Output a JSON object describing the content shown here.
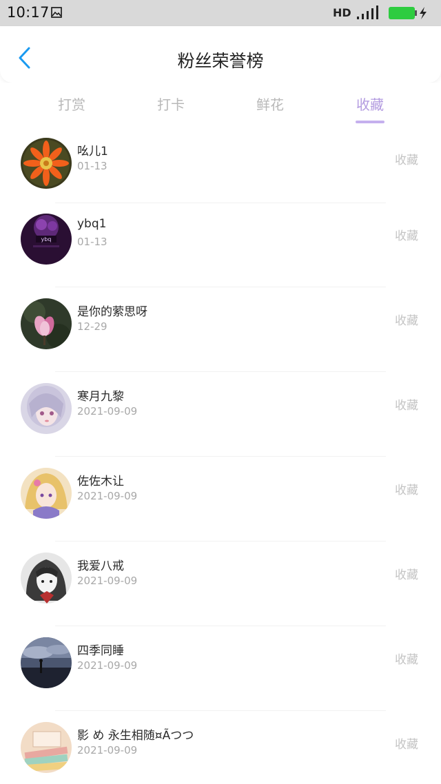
{
  "status_bar": {
    "time": "10:17",
    "network": "HD",
    "icons": [
      "gallery-icon",
      "signal-icon",
      "battery-icon"
    ],
    "battery_color": "#2ecc40"
  },
  "header": {
    "title": "粉丝荣誉榜",
    "back_icon": "chevron-left-icon",
    "accent": "#1a9af0"
  },
  "tabs": [
    {
      "label": "打赏",
      "active": false
    },
    {
      "label": "打卡",
      "active": false
    },
    {
      "label": "鲜花",
      "active": false
    },
    {
      "label": "收藏",
      "active": true
    }
  ],
  "active_tab_color": "#b39be0",
  "fans": [
    {
      "name": "吆儿1",
      "date": "01-13",
      "action": "收藏",
      "avatar": "orange-flower"
    },
    {
      "name": "ybq1",
      "date": "01-13",
      "action": "收藏",
      "avatar": "purple-logo"
    },
    {
      "name": "是你的萦思呀",
      "date": "12-29",
      "action": "收藏",
      "avatar": "pink-magnolia"
    },
    {
      "name": "寒月九黎",
      "date": "2021-09-09",
      "action": "收藏",
      "avatar": "anime-girl-silver"
    },
    {
      "name": "佐佐木让",
      "date": "2021-09-09",
      "action": "收藏",
      "avatar": "anime-girl-blonde"
    },
    {
      "name": "我爱八戒",
      "date": "2021-09-09",
      "action": "收藏",
      "avatar": "anime-girl-sketch"
    },
    {
      "name": "四季同睡",
      "date": "2021-09-09",
      "action": "收藏",
      "avatar": "lonely-figure-sky"
    },
    {
      "name": "影 め 永生相随¤Ãつつ",
      "date": "2021-09-09",
      "action": "收藏",
      "avatar": "books-pastel"
    }
  ]
}
